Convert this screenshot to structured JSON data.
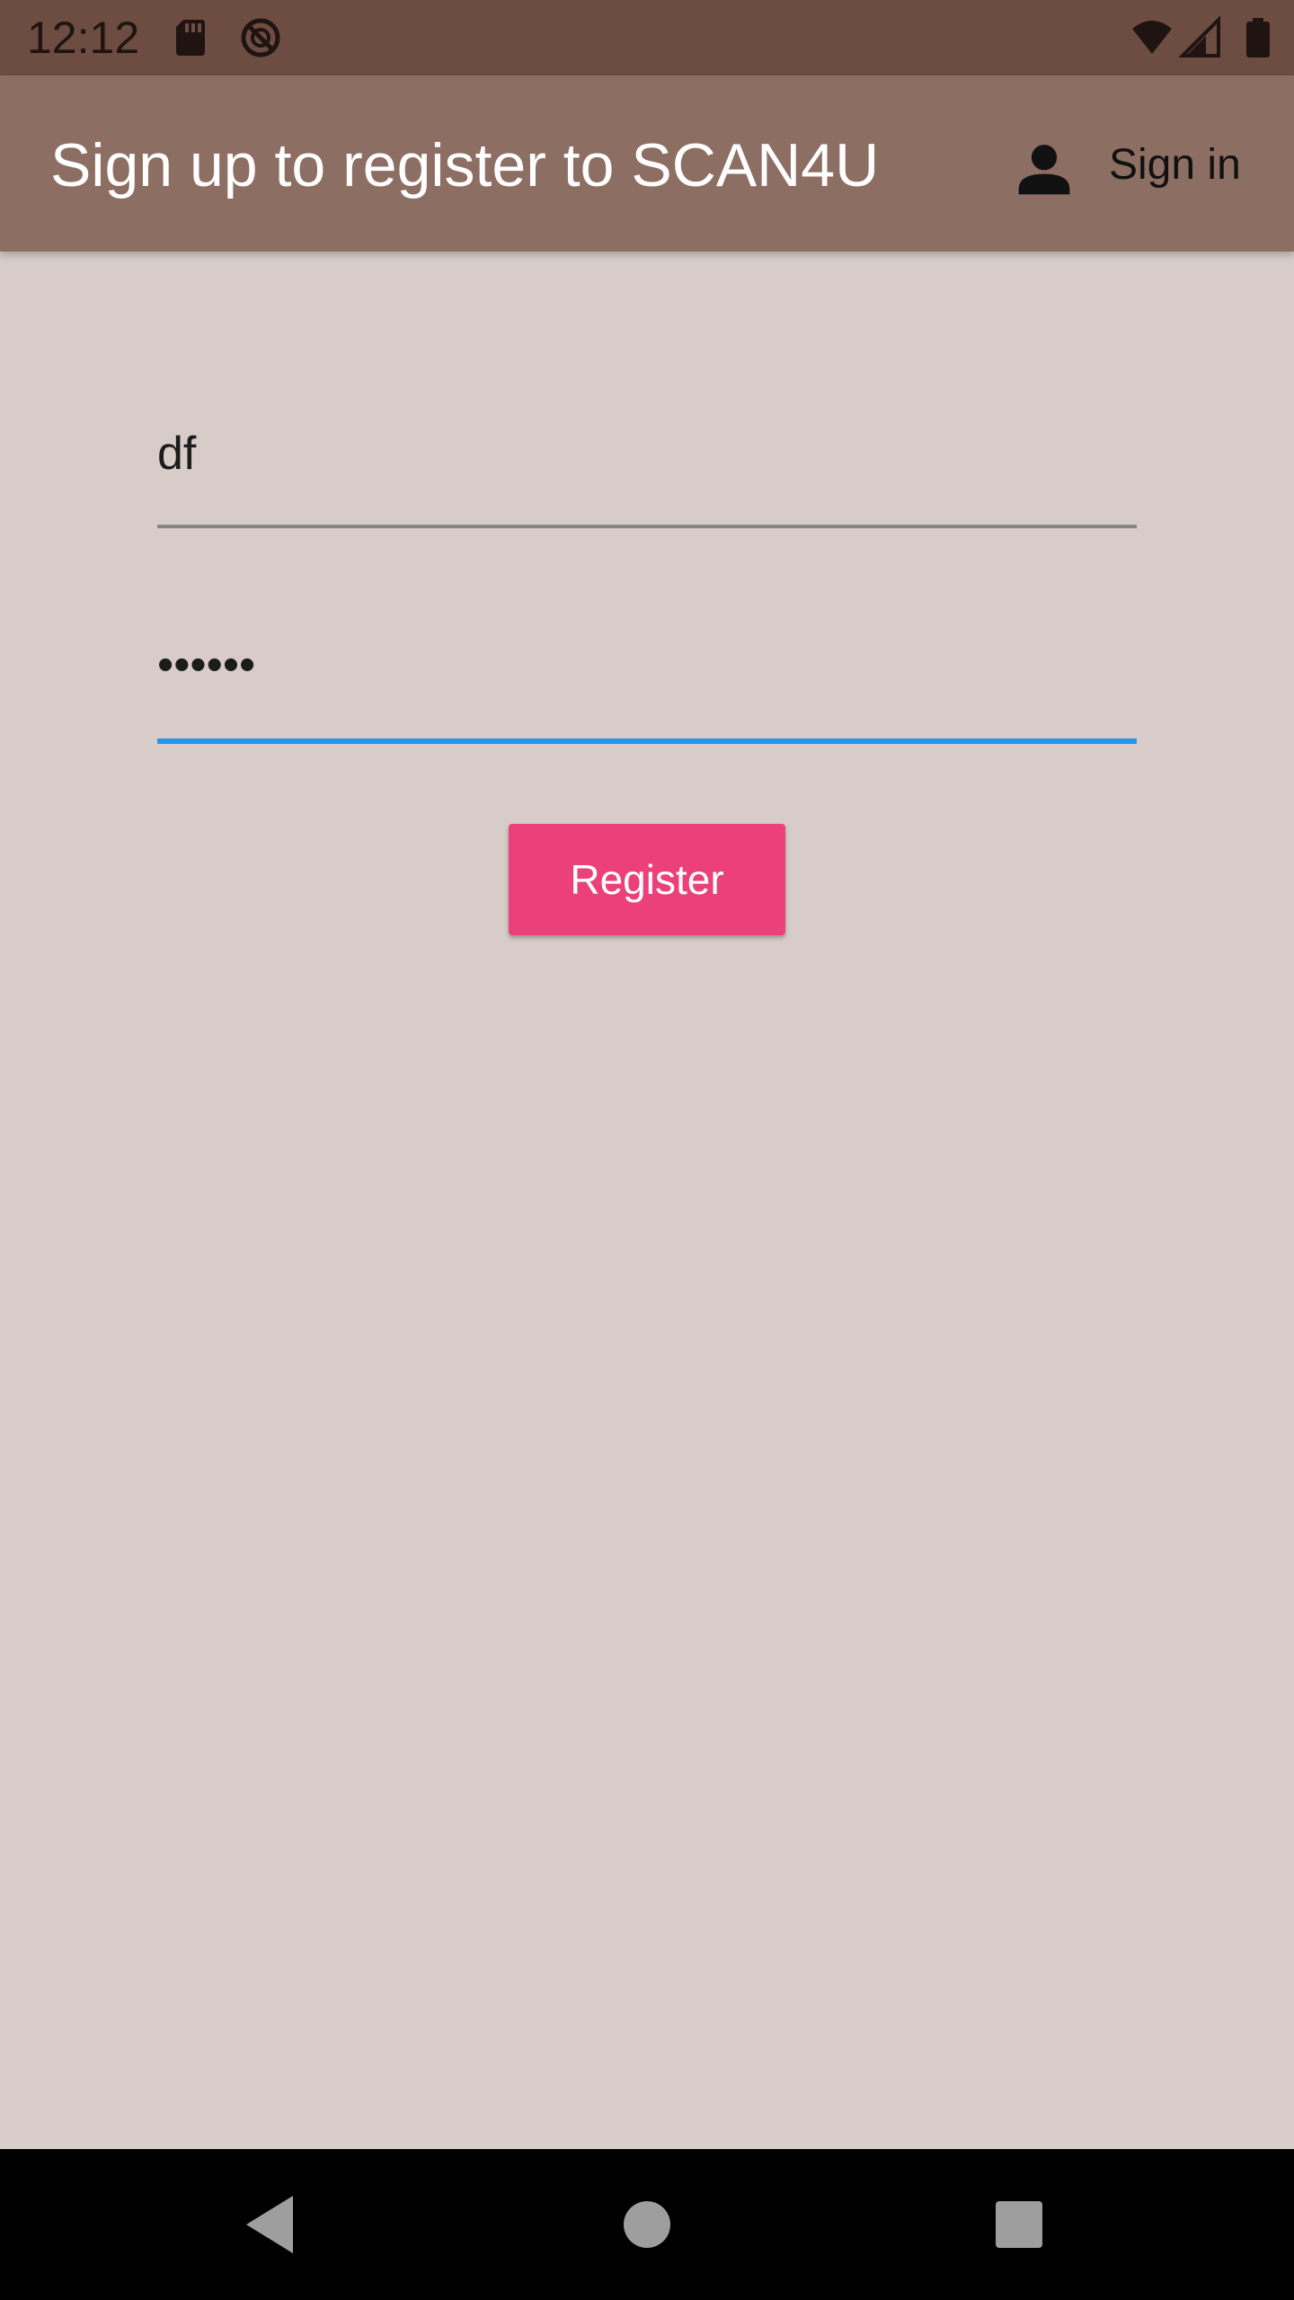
{
  "status_bar": {
    "time": "12:12",
    "icons": [
      "sd-card-icon",
      "do-not-disturb-icon",
      "wifi-icon",
      "signal-icon",
      "battery-icon"
    ]
  },
  "app_bar": {
    "title": "Sign up to register to SCAN4U",
    "sign_in_label": "Sign in",
    "sign_in_icon": "person-icon",
    "background": "#8d6e63"
  },
  "form": {
    "username_value": "df",
    "password_value": "••••••",
    "register_label": "Register"
  },
  "colors": {
    "page_background": "#d7ccc8",
    "accent": "#ec407a",
    "focus_underline": "#2196f3",
    "idle_underline": "#8a8583",
    "status_bar": "#6d4c41"
  },
  "nav_bar": {
    "buttons": [
      "back-icon",
      "home-icon",
      "recents-icon"
    ]
  }
}
